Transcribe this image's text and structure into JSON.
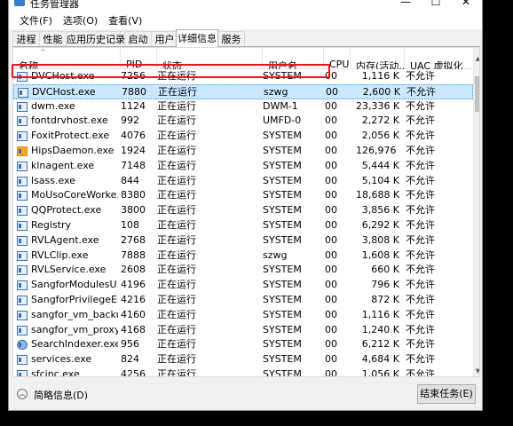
{
  "window": {
    "title": "任务管理器",
    "controls": {
      "minimize": "—",
      "maximize": "☐",
      "close": "✕"
    }
  },
  "menu": [
    "文件(F)",
    "选项(O)",
    "查看(V)"
  ],
  "tabs": [
    {
      "label": "进程",
      "active": false
    },
    {
      "label": "性能",
      "active": false
    },
    {
      "label": "应用历史记录",
      "active": false
    },
    {
      "label": "启动",
      "active": false
    },
    {
      "label": "用户",
      "active": false
    },
    {
      "label": "详细信息",
      "active": true
    },
    {
      "label": "服务",
      "active": false
    }
  ],
  "columns": [
    "名称",
    "PID",
    "状态",
    "用户名",
    "CPU",
    "内存(活动...",
    "UAC 虚拟化"
  ],
  "sort_indicator": "^",
  "processes": [
    {
      "name": "DVCHost.exe",
      "pid": "7256",
      "status": "正在运行",
      "user": "SYSTEM",
      "cpu": "00",
      "mem": "1,116 K",
      "uac": "不允许",
      "icon": "app-icon"
    },
    {
      "name": "DVCHost.exe",
      "pid": "7880",
      "status": "正在运行",
      "user": "szwg",
      "cpu": "00",
      "mem": "2,600 K",
      "uac": "不允许",
      "icon": "app-icon",
      "selected": true
    },
    {
      "name": "dwm.exe",
      "pid": "1124",
      "status": "正在运行",
      "user": "DWM-1",
      "cpu": "00",
      "mem": "23,336 K",
      "uac": "不允许",
      "icon": "app-icon"
    },
    {
      "name": "fontdrvhost.exe",
      "pid": "992",
      "status": "正在运行",
      "user": "UMFD-0",
      "cpu": "00",
      "mem": "2,272 K",
      "uac": "不允许",
      "icon": "app-icon"
    },
    {
      "name": "FoxitProtect.exe",
      "pid": "4076",
      "status": "正在运行",
      "user": "SYSTEM",
      "cpu": "00",
      "mem": "2,056 K",
      "uac": "不允许",
      "icon": "app-icon"
    },
    {
      "name": "HipsDaemon.exe",
      "pid": "1924",
      "status": "正在运行",
      "user": "SYSTEM",
      "cpu": "00",
      "mem": "126,976 K",
      "uac": "不允许",
      "icon": "hips-icon"
    },
    {
      "name": "klnagent.exe",
      "pid": "7148",
      "status": "正在运行",
      "user": "SYSTEM",
      "cpu": "00",
      "mem": "5,444 K",
      "uac": "不允许",
      "icon": "app-icon"
    },
    {
      "name": "lsass.exe",
      "pid": "844",
      "status": "正在运行",
      "user": "SYSTEM",
      "cpu": "00",
      "mem": "5,104 K",
      "uac": "不允许",
      "icon": "app-icon"
    },
    {
      "name": "MoUsoCoreWorke...",
      "pid": "8380",
      "status": "正在运行",
      "user": "SYSTEM",
      "cpu": "00",
      "mem": "18,688 K",
      "uac": "不允许",
      "icon": "app-icon"
    },
    {
      "name": "QQProtect.exe",
      "pid": "3800",
      "status": "正在运行",
      "user": "SYSTEM",
      "cpu": "00",
      "mem": "3,856 K",
      "uac": "不允许",
      "icon": "app-icon"
    },
    {
      "name": "Registry",
      "pid": "108",
      "status": "正在运行",
      "user": "SYSTEM",
      "cpu": "00",
      "mem": "6,292 K",
      "uac": "不允许",
      "icon": "app-icon"
    },
    {
      "name": "RVLAgent.exe",
      "pid": "2768",
      "status": "正在运行",
      "user": "SYSTEM",
      "cpu": "00",
      "mem": "3,808 K",
      "uac": "不允许",
      "icon": "app-icon"
    },
    {
      "name": "RVLClip.exe",
      "pid": "7888",
      "status": "正在运行",
      "user": "szwg",
      "cpu": "00",
      "mem": "1,608 K",
      "uac": "不允许",
      "icon": "app-icon"
    },
    {
      "name": "RVLService.exe",
      "pid": "2608",
      "status": "正在运行",
      "user": "SYSTEM",
      "cpu": "00",
      "mem": "660 K",
      "uac": "不允许",
      "icon": "app-icon"
    },
    {
      "name": "SangforModulesU...",
      "pid": "4196",
      "status": "正在运行",
      "user": "SYSTEM",
      "cpu": "00",
      "mem": "796 K",
      "uac": "不允许",
      "icon": "app-icon"
    },
    {
      "name": "SangforPrivilegeEl...",
      "pid": "4216",
      "status": "正在运行",
      "user": "SYSTEM",
      "cpu": "00",
      "mem": "872 K",
      "uac": "不允许",
      "icon": "app-icon"
    },
    {
      "name": "sangfor_vm_backu...",
      "pid": "4160",
      "status": "正在运行",
      "user": "SYSTEM",
      "cpu": "00",
      "mem": "1,116 K",
      "uac": "不允许",
      "icon": "app-icon"
    },
    {
      "name": "sangfor_vm_proxy_...",
      "pid": "4168",
      "status": "正在运行",
      "user": "SYSTEM",
      "cpu": "00",
      "mem": "1,240 K",
      "uac": "不允许",
      "icon": "app-icon"
    },
    {
      "name": "SearchIndexer.exe",
      "pid": "956",
      "status": "正在运行",
      "user": "SYSTEM",
      "cpu": "00",
      "mem": "6,212 K",
      "uac": "不允许",
      "icon": "search-indexer-icon"
    },
    {
      "name": "services.exe",
      "pid": "824",
      "status": "正在运行",
      "user": "SYSTEM",
      "cpu": "00",
      "mem": "4,684 K",
      "uac": "不允许",
      "icon": "app-icon"
    },
    {
      "name": "sfcinc.exe",
      "pid": "4256",
      "status": "正在运行",
      "user": "SYSTEM",
      "cpu": "00",
      "mem": "1,056 K",
      "uac": "不允许",
      "icon": "app-icon"
    }
  ],
  "footer": {
    "less_details": "简略信息(D)",
    "end_task": "结束任务(E)"
  },
  "colors": {
    "selection": "#cce8ff",
    "highlight_box": "#e8141c"
  }
}
